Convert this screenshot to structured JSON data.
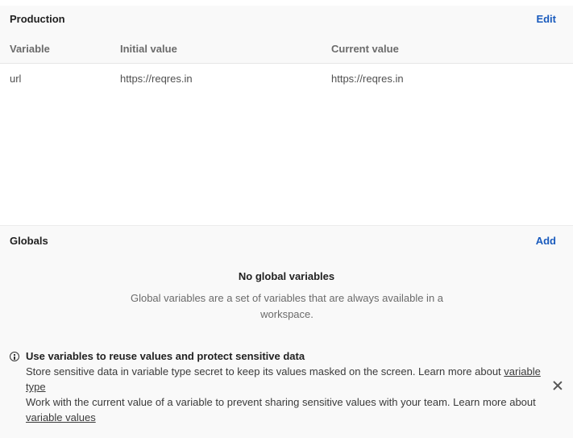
{
  "environment": {
    "title": "Production",
    "edit_label": "Edit",
    "columns": [
      "Variable",
      "Initial value",
      "Current value"
    ],
    "rows": [
      {
        "variable": "url",
        "initial": "https://reqres.in",
        "current": "https://reqres.in"
      }
    ]
  },
  "globals": {
    "title": "Globals",
    "add_label": "Add",
    "empty_title": "No global variables",
    "empty_description": "Global variables are a set of variables that are always available in a workspace."
  },
  "banner": {
    "icon": "info-icon",
    "title": "Use variables to reuse values and protect sensitive data",
    "line1_text": "Store sensitive data in variable type secret to keep its values masked on the screen. Learn more about ",
    "line1_link": "variable type",
    "line2_text": "Work with the current value of a variable to prevent sharing sensitive values with your team. Learn more about ",
    "line2_link": "variable values",
    "close_icon": "close-icon"
  },
  "colors": {
    "link": "#1a5bbd",
    "section_bg": "#f9f9f9"
  }
}
